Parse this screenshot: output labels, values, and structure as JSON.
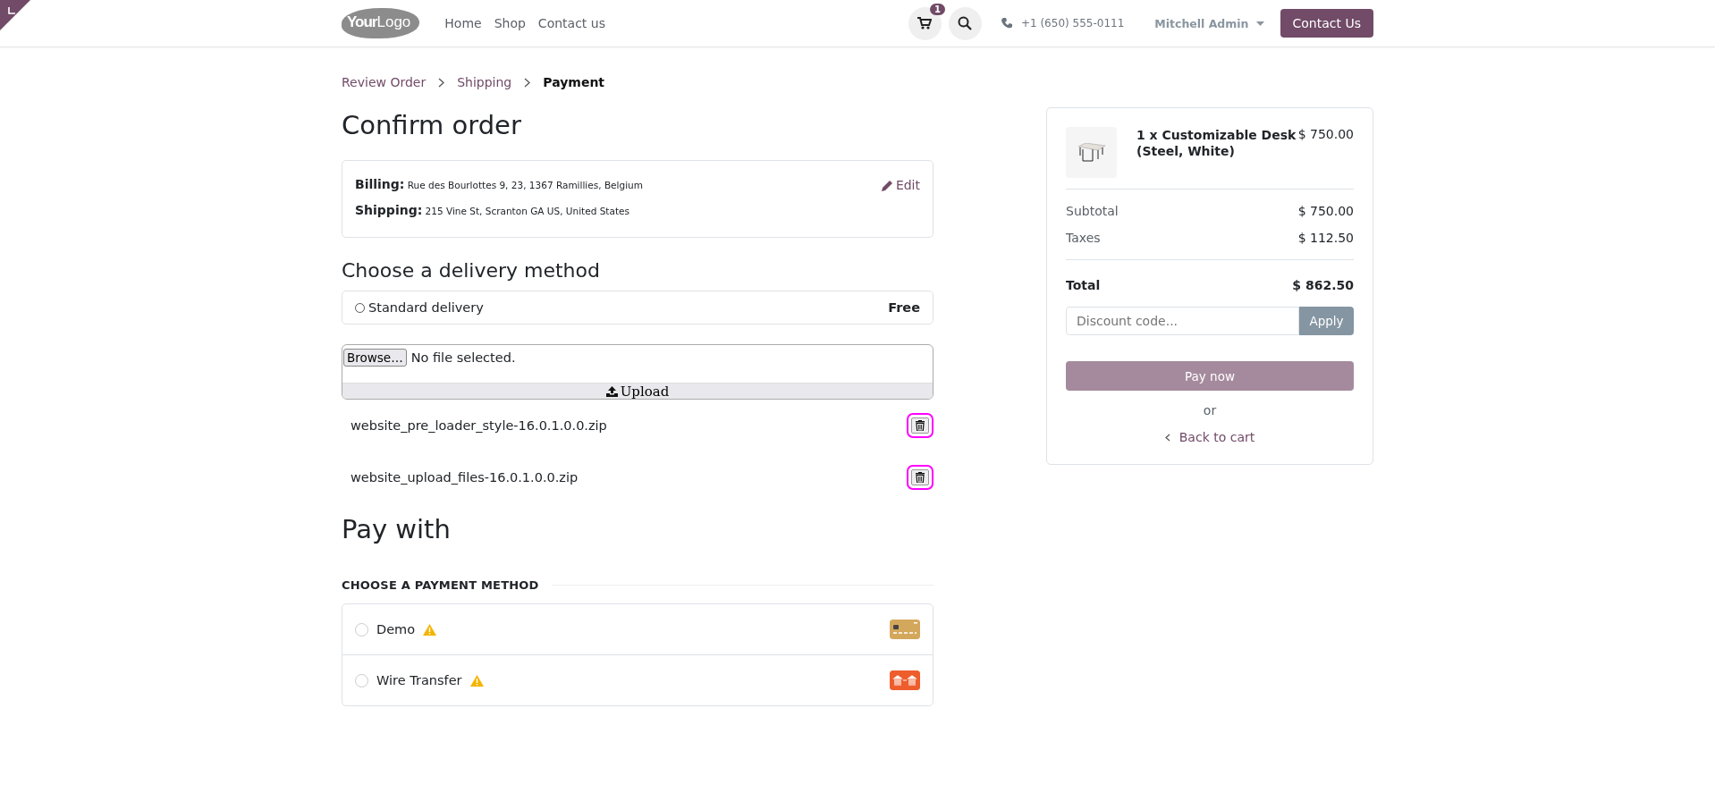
{
  "header": {
    "logo": {
      "part1": "Your",
      "part2": "Logo"
    },
    "nav": [
      {
        "label": "Home"
      },
      {
        "label": "Shop"
      },
      {
        "label": "Contact us"
      }
    ],
    "cart_count": "1",
    "phone": "+1 (650) 555-0111",
    "user": "Mitchell Admin",
    "cta": "Contact Us"
  },
  "breadcrumb": [
    {
      "label": "Review Order",
      "selected": false
    },
    {
      "label": "Shipping",
      "selected": false
    },
    {
      "label": "Payment",
      "selected": true
    }
  ],
  "title": "Confirm order",
  "addresses": [
    {
      "label": "Billing:",
      "value": "Rue des Bourlottes 9, 23, 1367 Ramillies, Belgium"
    },
    {
      "label": "Shipping:",
      "value": "215 Vine St, Scranton GA US, United States"
    }
  ],
  "edit_link": "Edit",
  "delivery": {
    "title": "Choose a delivery method",
    "methods": [
      {
        "name": "Standard delivery",
        "price": "Free",
        "selected": false
      }
    ]
  },
  "upload": {
    "browse": "Browse…",
    "status": "No file selected.",
    "button": "Upload",
    "files": [
      {
        "name": "website_pre_loader_style-16.0.1.0.0.zip"
      },
      {
        "name": "website_upload_files-16.0.1.0.0.zip"
      }
    ]
  },
  "pay_with": {
    "title": "Pay with",
    "subtitle": "CHOOSE A PAYMENT METHOD",
    "methods": [
      {
        "name": "Demo",
        "kind": "card",
        "selected": false,
        "warning": true,
        "color": "#d4a85c"
      },
      {
        "name": "Wire Transfer",
        "kind": "bank",
        "selected": false,
        "warning": true,
        "color": "#ee5d2c"
      }
    ]
  },
  "summary": {
    "item": {
      "name": "1 x Customizable Desk (Steel, White)",
      "price": "$ 750.00"
    },
    "lines": [
      {
        "label": "Subtotal",
        "value": "$ 750.00"
      },
      {
        "label": "Taxes",
        "value": "$ 112.50"
      }
    ],
    "total": {
      "label": "Total",
      "value": "$ 862.50"
    },
    "discount_placeholder": "Discount code...",
    "apply": "Apply",
    "pay": {
      "label": "Pay now",
      "disabled": true
    },
    "or": "or",
    "back": "Back to cart"
  }
}
